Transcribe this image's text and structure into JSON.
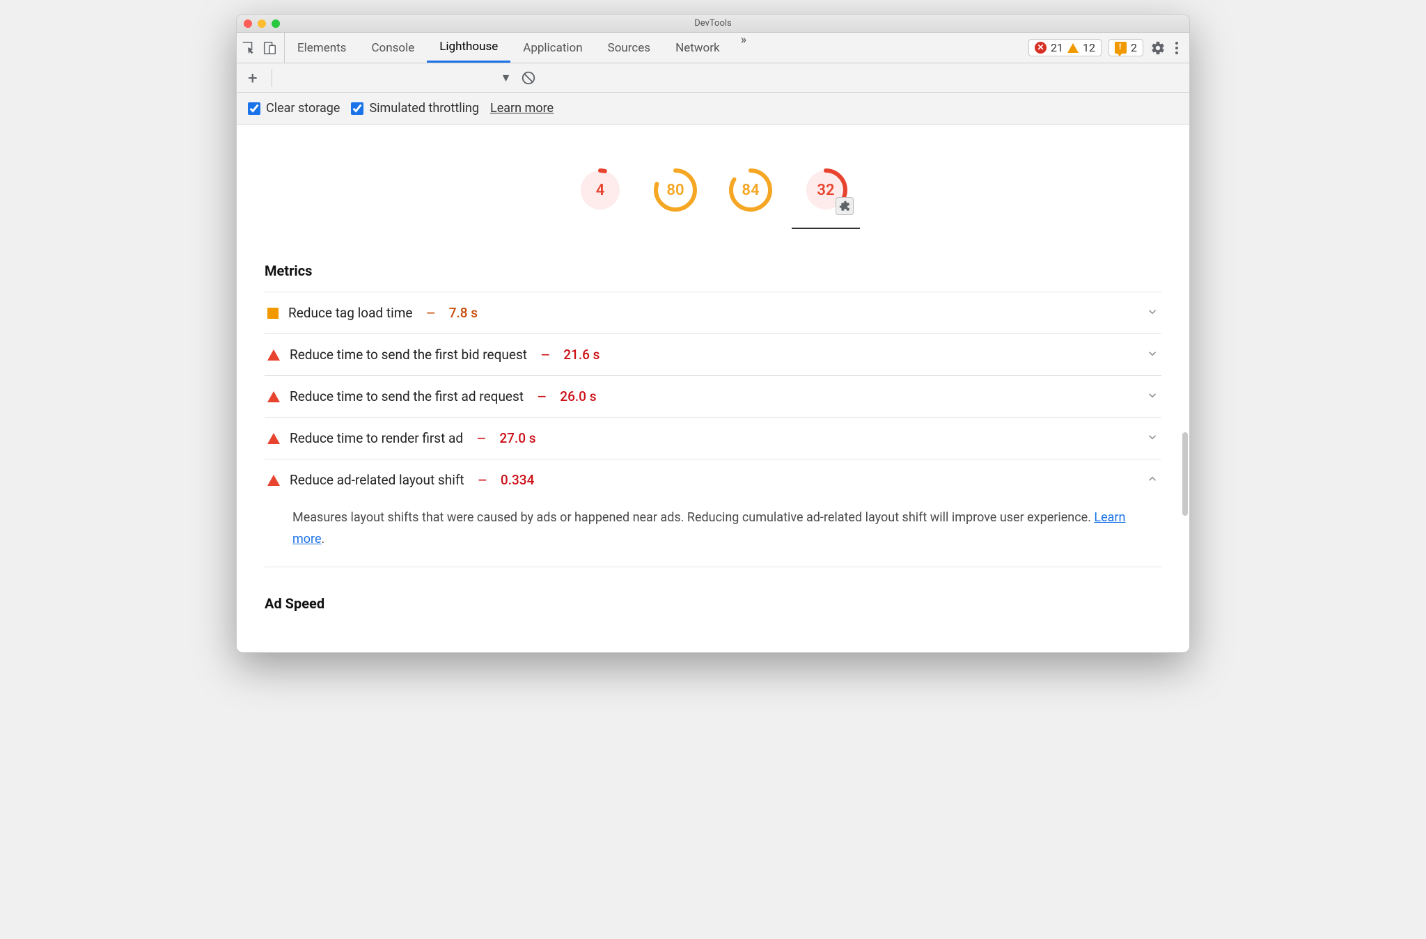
{
  "window": {
    "title": "DevTools"
  },
  "tabs": {
    "elements": "Elements",
    "console": "Console",
    "lighthouse": "Lighthouse",
    "application": "Application",
    "sources": "Sources",
    "network": "Network"
  },
  "counters": {
    "errors": "21",
    "warnings": "12",
    "messages": "2"
  },
  "options": {
    "clear_storage": "Clear storage",
    "simulated_throttling": "Simulated throttling",
    "learn_more": "Learn more"
  },
  "gauges": [
    {
      "score": "4",
      "pct": 0.04,
      "color": "#e8432f",
      "bg": "#fdeceb",
      "selected": false,
      "ext": false
    },
    {
      "score": "80",
      "pct": 0.8,
      "color": "#f5a623",
      "bg": "#ffffff",
      "selected": false,
      "ext": false
    },
    {
      "score": "84",
      "pct": 0.84,
      "color": "#f5a623",
      "bg": "#ffffff",
      "selected": false,
      "ext": false
    },
    {
      "score": "32",
      "pct": 0.32,
      "color": "#e8432f",
      "bg": "#fdeceb",
      "selected": true,
      "ext": true
    }
  ],
  "sections": {
    "metrics": "Metrics",
    "ad_speed": "Ad Speed"
  },
  "metrics": [
    {
      "icon": "square",
      "title": "Reduce tag load time",
      "dash": "—",
      "value": "7.8 s",
      "valClass": "orange",
      "open": false
    },
    {
      "icon": "triangle",
      "title": "Reduce time to send the first bid request",
      "dash": "—",
      "value": "21.6 s",
      "valClass": "",
      "open": false
    },
    {
      "icon": "triangle",
      "title": "Reduce time to send the first ad request",
      "dash": "—",
      "value": "26.0 s",
      "valClass": "",
      "open": false
    },
    {
      "icon": "triangle",
      "title": "Reduce time to render first ad",
      "dash": "—",
      "value": "27.0 s",
      "valClass": "",
      "open": false
    },
    {
      "icon": "triangle",
      "title": "Reduce ad-related layout shift",
      "dash": "—",
      "value": "0.334",
      "valClass": "",
      "open": true
    }
  ],
  "metric_detail": {
    "text_a": "Measures layout shifts that were caused by ads or happened near ads. Reducing cumulative ad-related layout shift will improve user experience. ",
    "learn_more": "Learn more",
    "period": "."
  }
}
